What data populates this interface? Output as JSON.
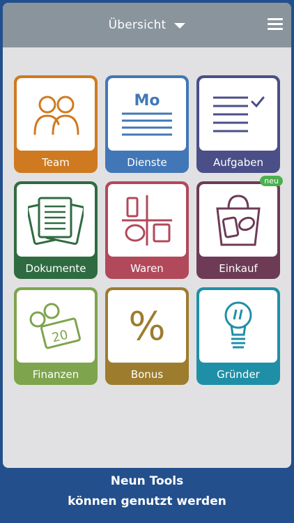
{
  "header": {
    "title": "Übersicht",
    "dropdown_icon": "chevron-down-icon",
    "menu_icon": "hamburger-menu-icon"
  },
  "tiles": [
    {
      "label": "Team",
      "color": "#cf7a21",
      "icon": "team-icon"
    },
    {
      "label": "Dienste",
      "color": "#4277b7",
      "icon": "calendar-day-icon",
      "icon_text": "Mo"
    },
    {
      "label": "Aufgaben",
      "color": "#4a4f87",
      "icon": "checklist-icon"
    },
    {
      "label": "Dokumente",
      "color": "#2f6b41",
      "icon": "documents-icon"
    },
    {
      "label": "Waren",
      "color": "#b1495b",
      "icon": "goods-icon"
    },
    {
      "label": "Einkauf",
      "color": "#6d3b55",
      "icon": "shopping-bag-icon",
      "badge": "neu"
    },
    {
      "label": "Finanzen",
      "color": "#7ea44d",
      "icon": "money-icon",
      "icon_text": "20"
    },
    {
      "label": "Bonus",
      "color": "#9d7c2e",
      "icon": "percent-icon",
      "icon_text": "%"
    },
    {
      "label": "Gründer",
      "color": "#1f8fa7",
      "icon": "lightbulb-icon"
    }
  ],
  "footer": {
    "line1": "Neun Tools",
    "line2": "können genutzt werden"
  }
}
